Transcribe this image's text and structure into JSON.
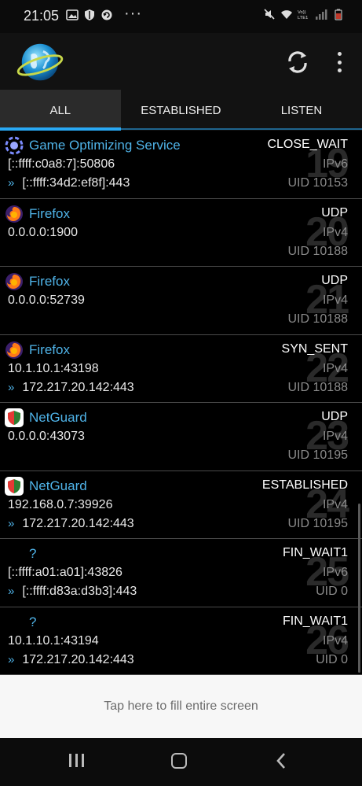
{
  "status_bar": {
    "time": "21:05",
    "more_indicator": "···",
    "left_icons": [
      "image-icon",
      "shield-icon",
      "sync-icon"
    ],
    "right_icons": [
      "mute-icon",
      "wifi-icon",
      "volte-icon",
      "signal-icon",
      "battery-icon"
    ]
  },
  "app_bar": {
    "logo_icon": "globe-network-icon",
    "refresh_icon": "refresh-icon",
    "menu_icon": "overflow-menu-icon"
  },
  "tabs": [
    {
      "label": "ALL",
      "active": true
    },
    {
      "label": "ESTABLISHED",
      "active": false
    },
    {
      "label": "LISTEN",
      "active": false
    }
  ],
  "connections": [
    {
      "app": "Game Optimizing Service",
      "icon": "game-optimizer-icon",
      "state": "CLOSE_WAIT",
      "local": "[::ffff:c0a8:7]:50806",
      "remote": "[::ffff:34d2:ef8f]:443",
      "arrow": "»",
      "ip": "IPv6",
      "uid": "UID 10153",
      "num": "19"
    },
    {
      "app": "Firefox",
      "icon": "firefox-icon",
      "state": "UDP",
      "local": "0.0.0.0:1900",
      "remote": "",
      "arrow": "",
      "ip": "IPv4",
      "uid": "UID 10188",
      "num": "20"
    },
    {
      "app": "Firefox",
      "icon": "firefox-icon",
      "state": "UDP",
      "local": "0.0.0.0:52739",
      "remote": "",
      "arrow": "",
      "ip": "IPv4",
      "uid": "UID 10188",
      "num": "21"
    },
    {
      "app": "Firefox",
      "icon": "firefox-icon",
      "state": "SYN_SENT",
      "local": "10.1.10.1:43198",
      "remote": "172.217.20.142:443",
      "arrow": "»",
      "ip": "IPv4",
      "uid": "UID 10188",
      "num": "22"
    },
    {
      "app": "NetGuard",
      "icon": "netguard-icon",
      "state": "UDP",
      "local": "0.0.0.0:43073",
      "remote": "",
      "arrow": "",
      "ip": "IPv4",
      "uid": "UID 10195",
      "num": "23"
    },
    {
      "app": "NetGuard",
      "icon": "netguard-icon",
      "state": "ESTABLISHED",
      "local": "192.168.0.7:39926",
      "remote": "172.217.20.142:443",
      "arrow": "»",
      "ip": "IPv4",
      "uid": "UID 10195",
      "num": "24"
    },
    {
      "app": "?",
      "icon": "",
      "state": "FIN_WAIT1",
      "local": "[::ffff:a01:a01]:43826",
      "remote": "[::ffff:d83a:d3b3]:443",
      "arrow": "»",
      "ip": "IPv6",
      "uid": "UID 0",
      "num": "25"
    },
    {
      "app": "?",
      "icon": "",
      "state": "FIN_WAIT1",
      "local": "10.1.10.1:43194",
      "remote": "172.217.20.142:443",
      "arrow": "»",
      "ip": "IPv4",
      "uid": "UID 0",
      "num": "26"
    }
  ],
  "banner": {
    "text": "Tap here to fill entire screen"
  },
  "nav_bar": {
    "recent_icon": "recent-apps-icon",
    "home_icon": "home-icon",
    "back_icon": "back-icon"
  },
  "colors": {
    "accent": "#29a9f4",
    "app_name": "#4fb3e8",
    "background": "#000000"
  }
}
